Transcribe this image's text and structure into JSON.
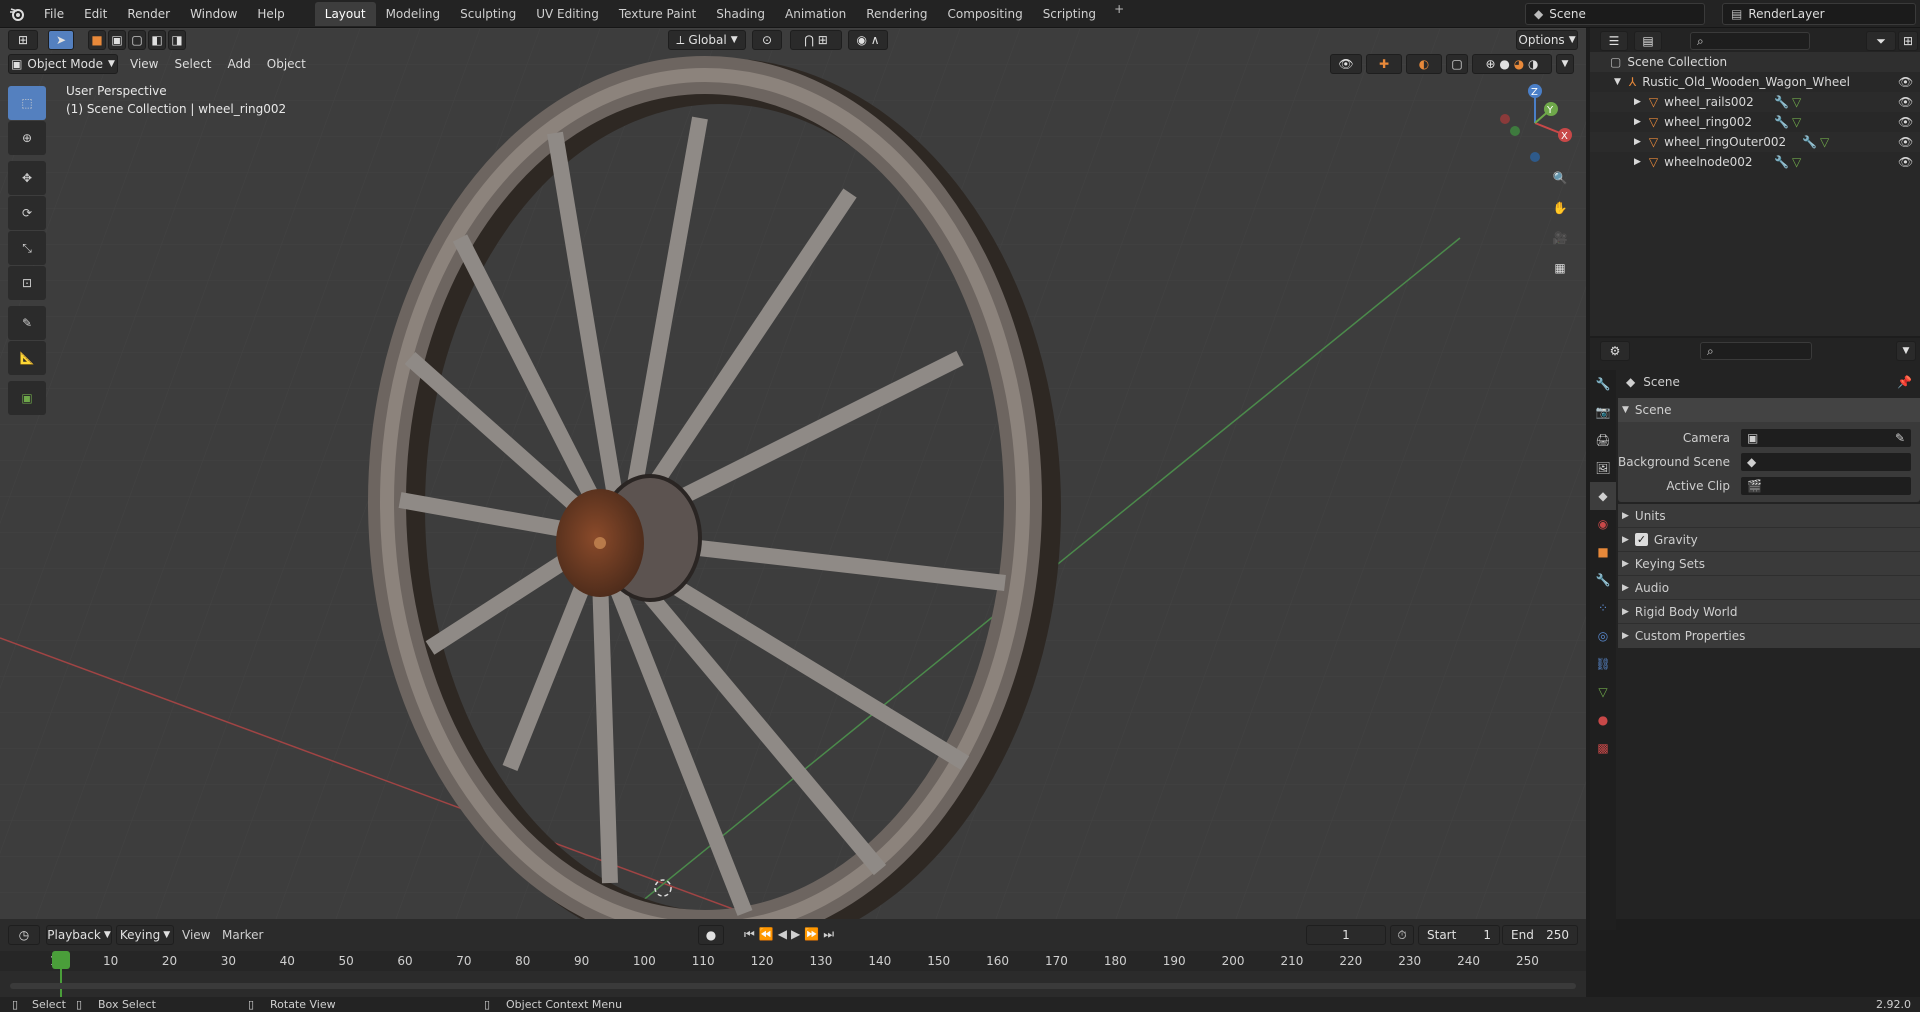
{
  "topbar": {
    "menus": [
      "File",
      "Edit",
      "Render",
      "Window",
      "Help"
    ],
    "workspaces": [
      "Layout",
      "Modeling",
      "Sculpting",
      "UV Editing",
      "Texture Paint",
      "Shading",
      "Animation",
      "Rendering",
      "Compositing",
      "Scripting"
    ],
    "active_workspace": "Layout",
    "scene_name": "Scene",
    "render_layer": "RenderLayer"
  },
  "viewport": {
    "mode": "Object Mode",
    "menus": [
      "View",
      "Select",
      "Add",
      "Object"
    ],
    "orientation": "Global",
    "options_label": "Options",
    "perspective_label": "User Perspective",
    "collection_label": "(1) Scene Collection | wheel_ring002",
    "axes": {
      "x": "X",
      "y": "Y",
      "z": "Z"
    }
  },
  "outliner": {
    "root": "Scene Collection",
    "object": "Rustic_Old_Wooden_Wagon_Wheel",
    "children": [
      "wheel_rails002",
      "wheel_ring002",
      "wheel_ringOuter002",
      "wheelnode002"
    ]
  },
  "properties": {
    "context": "Scene",
    "panel_title": "Scene",
    "fields": [
      {
        "label": "Camera",
        "value": ""
      },
      {
        "label": "Background Scene",
        "value": ""
      },
      {
        "label": "Active Clip",
        "value": ""
      }
    ],
    "panels": [
      "Units",
      "Gravity",
      "Keying Sets",
      "Audio",
      "Rigid Body World",
      "Custom Properties"
    ],
    "gravity_checked": true
  },
  "timeline": {
    "menus": [
      "Playback",
      "Keying",
      "View",
      "Marker"
    ],
    "current_frame": "1",
    "start_label": "Start",
    "start": "1",
    "end_label": "End",
    "end": "250",
    "ruler": [
      "1",
      "10",
      "20",
      "30",
      "40",
      "50",
      "60",
      "70",
      "80",
      "90",
      "100",
      "110",
      "120",
      "130",
      "140",
      "150",
      "160",
      "170",
      "180",
      "190",
      "200",
      "210",
      "220",
      "230",
      "240",
      "250"
    ]
  },
  "status": {
    "select": "Select",
    "box_select": "Box Select",
    "rotate": "Rotate View",
    "context_menu": "Object Context Menu",
    "version": "2.92.0"
  },
  "colors": {
    "accent": "#5480bf",
    "active_frame": "#4a9e3a",
    "x_axis": "#c84848",
    "y_axis": "#6fa84a",
    "z_axis": "#4a7fc8",
    "object_orange": "#e8893a"
  }
}
